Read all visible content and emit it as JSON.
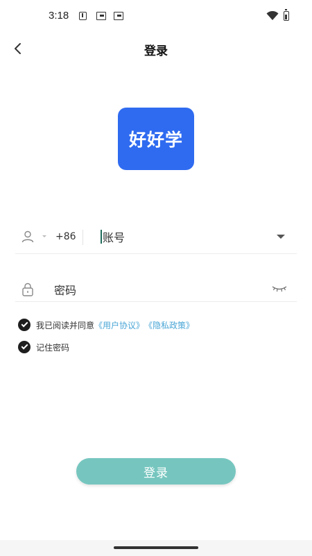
{
  "status_bar": {
    "time": "3:18",
    "icons": [
      "download-icon",
      "window-icon",
      "window-icon",
      "wifi-icon",
      "battery-icon"
    ]
  },
  "header": {
    "title": "登录",
    "back_icon": "chevron-left-icon"
  },
  "logo": {
    "text": "好好学",
    "color": "#2f6bf0"
  },
  "account": {
    "country_code": "+86",
    "placeholder": "账号",
    "icon": "user-icon"
  },
  "password": {
    "placeholder": "密码",
    "icon": "lock-icon",
    "toggle_icon": "eye-closed-icon"
  },
  "agreement": {
    "prefix": "我已阅读并同意",
    "user_agreement": "《用户协议》",
    "privacy_policy": "《隐私政策》",
    "checked": true
  },
  "remember": {
    "label": "记住密码",
    "checked": true
  },
  "login_button": {
    "label": "登录",
    "color": "#76c6bf"
  },
  "colors": {
    "accent": "#76c6bf",
    "link": "#4aa6d6",
    "brand": "#2f6bf0"
  }
}
